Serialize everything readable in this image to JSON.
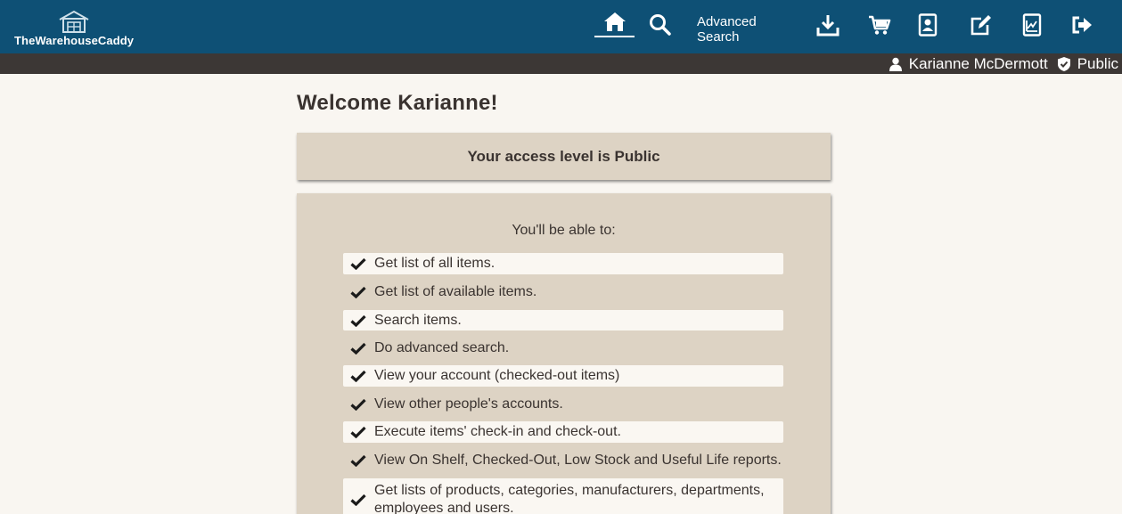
{
  "brand": {
    "name": "TheWarehouseCaddy"
  },
  "nav": {
    "advanced_search_label": "Advanced Search",
    "icons": [
      "home-icon",
      "search-icon",
      "download-icon",
      "cart-icon",
      "account-icon",
      "edit-icon",
      "reports-icon",
      "logout-icon"
    ]
  },
  "user": {
    "name": "Karianne McDermott",
    "role": "Public"
  },
  "main": {
    "welcome": "Welcome Karianne!",
    "access_level": "Your access level is Public",
    "permissions_title": "You'll be able to:",
    "permissions": [
      "Get list of all items.",
      "Get list of available items.",
      "Search items.",
      "Do advanced search.",
      "View your account (checked-out items)",
      "View other people's accounts.",
      "Execute items' check-in and check-out.",
      "View On Shelf, Checked-Out, Low Stock and Useful Life reports.",
      "Get lists of products, categories, manufacturers, departments, employees and users."
    ]
  },
  "colors": {
    "navbar": "#0e5075",
    "subbar": "#3c3735",
    "panel": "#ddd3c4",
    "page": "#f9f6f1"
  }
}
